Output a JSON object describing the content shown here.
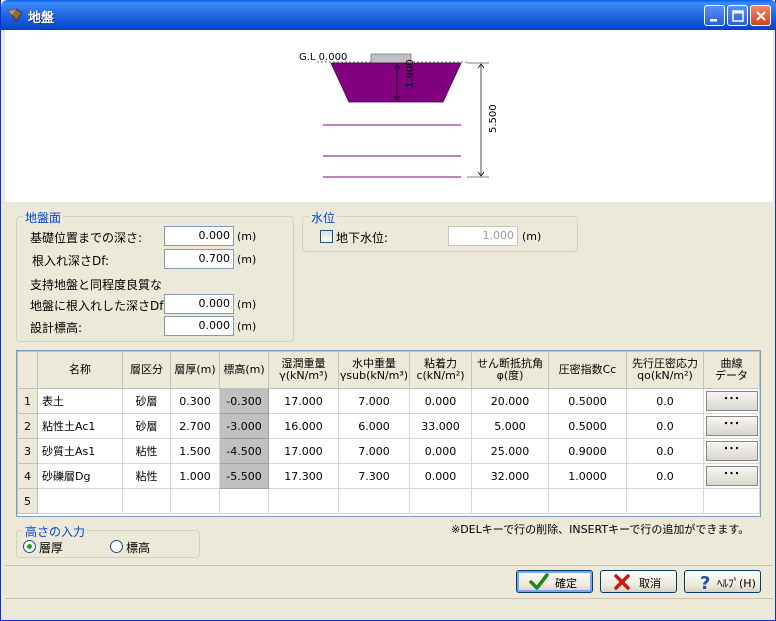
{
  "window": {
    "title": "地盤"
  },
  "diagram": {
    "gl_label": "G.L 0.000",
    "footing_depth": "1.900",
    "total_depth": "5.500",
    "colors": {
      "footing": "#800080",
      "layer_line": "#800080",
      "cap": "#c0c0c0"
    }
  },
  "ground_surface": {
    "legend": "地盤面",
    "depth_to_base": {
      "label": "基礎位置までの深さ:",
      "value": "0.000",
      "unit": "(m)"
    },
    "embed_depth": {
      "label": "根入れ深さDf:",
      "value": "0.700",
      "unit": "(m)"
    },
    "note_line1": "支持地盤と同程度良質な",
    "embed_depth_good": {
      "label": "地盤に根入れした深さDf':",
      "value": "0.000",
      "unit": "(m)"
    },
    "design_elevation": {
      "label": "設計標高:",
      "value": "0.000",
      "unit": "(m)"
    }
  },
  "water_level": {
    "legend": "水位",
    "groundwater": {
      "label": "地下水位:",
      "checked": false,
      "value": "1.000",
      "unit": "(m)"
    }
  },
  "grid": {
    "headers": [
      {
        "l1": "",
        "l2": ""
      },
      {
        "l1": "名称",
        "l2": ""
      },
      {
        "l1": "層区分",
        "l2": ""
      },
      {
        "l1": "層厚(m)",
        "l2": ""
      },
      {
        "l1": "標高(m)",
        "l2": ""
      },
      {
        "l1": "湿潤重量",
        "l2": "γ(kN/m³)"
      },
      {
        "l1": "水中重量",
        "l2": "γsub(kN/m³)"
      },
      {
        "l1": "粘着力",
        "l2": "c(kN/m²)"
      },
      {
        "l1": "せん断抵抗角",
        "l2": "φ(度)"
      },
      {
        "l1": "圧密指数Cc",
        "l2": ""
      },
      {
        "l1": "先行圧密応力",
        "l2": "qo(kN/m²)"
      },
      {
        "l1": "曲線",
        "l2": "データ"
      }
    ],
    "rows": [
      {
        "no": "1",
        "name": "表土",
        "type": "砂層",
        "thickness": "0.300",
        "elevation": "-0.300",
        "gamma": "17.000",
        "gamma_sub": "7.000",
        "c": "0.000",
        "phi": "20.000",
        "cc": "0.5000",
        "qo": "0.0",
        "curve": "･･･"
      },
      {
        "no": "2",
        "name": "粘性土Ac1",
        "type": "砂層",
        "thickness": "2.700",
        "elevation": "-3.000",
        "gamma": "16.000",
        "gamma_sub": "6.000",
        "c": "33.000",
        "phi": "5.000",
        "cc": "0.5000",
        "qo": "0.0",
        "curve": "･･･"
      },
      {
        "no": "3",
        "name": "砂質土As1",
        "type": "粘性",
        "thickness": "1.500",
        "elevation": "-4.500",
        "gamma": "17.000",
        "gamma_sub": "7.000",
        "c": "0.000",
        "phi": "25.000",
        "cc": "0.9000",
        "qo": "0.0",
        "curve": "･･･"
      },
      {
        "no": "4",
        "name": "砂礫層Dg",
        "type": "粘性",
        "thickness": "1.000",
        "elevation": "-5.500",
        "gamma": "17.300",
        "gamma_sub": "7.300",
        "c": "0.000",
        "phi": "32.000",
        "cc": "1.0000",
        "qo": "0.0",
        "curve": "･･･"
      }
    ],
    "empty_row_no": "5"
  },
  "note": "※DELキーで行の削除、INSERTキーで行の追加ができます。",
  "height_input": {
    "legend": "高さの入力",
    "options": [
      {
        "label": "層厚",
        "selected": true
      },
      {
        "label": "標高",
        "selected": false
      }
    ]
  },
  "buttons": {
    "ok": "確定",
    "cancel": "取消",
    "help": "ﾍﾙﾌﾟ(H)"
  }
}
